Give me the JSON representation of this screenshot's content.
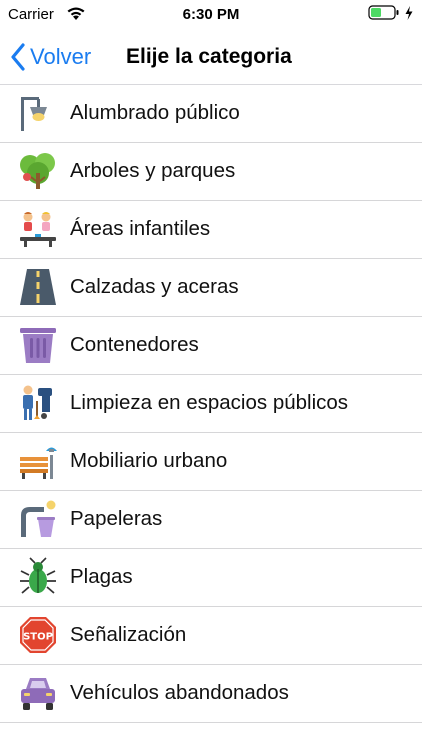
{
  "status_bar": {
    "carrier": "Carrier",
    "time": "6:30 PM"
  },
  "nav": {
    "back_label": "Volver",
    "title": "Elije la categoria"
  },
  "categories": [
    {
      "label": "Alumbrado público",
      "icon": "streetlight-icon"
    },
    {
      "label": "Arboles y parques",
      "icon": "tree-icon"
    },
    {
      "label": "Áreas infantiles",
      "icon": "playground-icon"
    },
    {
      "label": "Calzadas y aceras",
      "icon": "road-icon"
    },
    {
      "label": "Contenedores",
      "icon": "container-icon"
    },
    {
      "label": "Limpieza en espacios públicos",
      "icon": "street-cleaner-icon"
    },
    {
      "label": "Mobiliario urbano",
      "icon": "bench-icon"
    },
    {
      "label": "Papeleras",
      "icon": "waste-bin-icon"
    },
    {
      "label": "Plagas",
      "icon": "bug-icon"
    },
    {
      "label": "Señalización",
      "icon": "stop-sign-icon"
    },
    {
      "label": "Vehículos abandonados",
      "icon": "car-icon"
    }
  ],
  "colors": {
    "accent": "#1a7cf0",
    "battery": "#4cd964"
  }
}
